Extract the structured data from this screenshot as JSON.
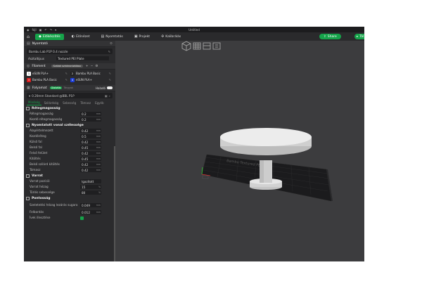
{
  "window": {
    "app_label": "fájl",
    "title": "Untitled"
  },
  "toolbar": {
    "tabs": [
      {
        "label": "Előkészítés",
        "icon": "prepare-icon",
        "active": true
      },
      {
        "label": "Előnézet",
        "icon": "preview-icon",
        "active": false
      },
      {
        "label": "Nyomtatás",
        "icon": "printer-icon",
        "active": false
      },
      {
        "label": "Projekt",
        "icon": "project-icon",
        "active": false
      },
      {
        "label": "Kalibrálás",
        "icon": "calibration-icon",
        "active": false
      }
    ],
    "share_label": "Share",
    "slice_label": "Tál",
    "accent": "#16a34a"
  },
  "printer": {
    "section_label": "Nyomtató",
    "printer_name": "Bambu Lab P1P 0.4 nozzle",
    "plate_label": "Asztaltípus",
    "plate_value": "Textured PEI Plate"
  },
  "filament": {
    "section_label": "Filament",
    "sync_label": "Szálak szinkronizálása",
    "items": [
      {
        "num": "1",
        "name": "eSUN PLA+",
        "color": "#ffffff"
      },
      {
        "num": "2",
        "name": "Bambu PLA Basic",
        "color": "#222222"
      },
      {
        "num": "3",
        "name": "Bambu PLA Basic",
        "color": "#d81e1e"
      },
      {
        "num": "4",
        "name": "eSUN PLA+",
        "color": "#1e3fd8"
      }
    ]
  },
  "process": {
    "section_label": "Folyamat",
    "global_label": "Globális",
    "object_label": "Tárgyak",
    "advanced_label": "Haladó",
    "profile": "0.20mm Standard @BBL P1P",
    "tabs": [
      {
        "label": "Minőség",
        "active": true
      },
      {
        "label": "Szilárdság",
        "active": false
      },
      {
        "label": "Sebesség",
        "active": false
      },
      {
        "label": "Támasz",
        "active": false
      },
      {
        "label": "Egyéb",
        "active": false
      }
    ],
    "groups": [
      {
        "title": "Rétegmagasság",
        "props": [
          {
            "label": "Rétegmagasság",
            "value": "0.2",
            "unit": "mm"
          },
          {
            "label": "Kezdő rétegmagasság",
            "value": "0.2",
            "unit": "mm"
          }
        ]
      },
      {
        "title": "Nyomtatott vonal szélessége",
        "props": [
          {
            "label": "Alapértelmezett",
            "value": "0.42",
            "unit": "mm"
          },
          {
            "label": "Kezdőréteg",
            "value": "0.5",
            "unit": "mm"
          },
          {
            "label": "Külső fal",
            "value": "0.42",
            "unit": "mm"
          },
          {
            "label": "Belső fal",
            "value": "0.45",
            "unit": "mm"
          },
          {
            "label": "Felső felület",
            "value": "0.42",
            "unit": "mm"
          },
          {
            "label": "Kitöltés",
            "value": "0.45",
            "unit": "mm"
          },
          {
            "label": "Belső szilárd kitöltés",
            "value": "0.42",
            "unit": "mm"
          },
          {
            "label": "Támasz",
            "value": "0.42",
            "unit": "mm"
          }
        ]
      },
      {
        "title": "Varrat",
        "props": [
          {
            "label": "Varrat pozíció",
            "value": "Igazított",
            "unit": ""
          },
          {
            "label": "Varrat hézag",
            "value": "15",
            "unit": "%"
          },
          {
            "label": "Törlés sebessége",
            "value": "80",
            "unit": "%"
          }
        ]
      },
      {
        "title": "Pontosság",
        "props": [
          {
            "label": "Szeletelési hézag lezárás sugara",
            "value": "0.049",
            "unit": "mm"
          },
          {
            "label": "Felbontás",
            "value": "0.012",
            "unit": "mm"
          },
          {
            "label": "Ívek illesztése",
            "value": "",
            "unit": "",
            "checkbox": true
          }
        ]
      }
    ]
  },
  "viewport": {
    "bed_label": "Bambu Textured PEI Plate",
    "bed_color": "#1a1a1a",
    "model_color": "#dcdcdc"
  }
}
